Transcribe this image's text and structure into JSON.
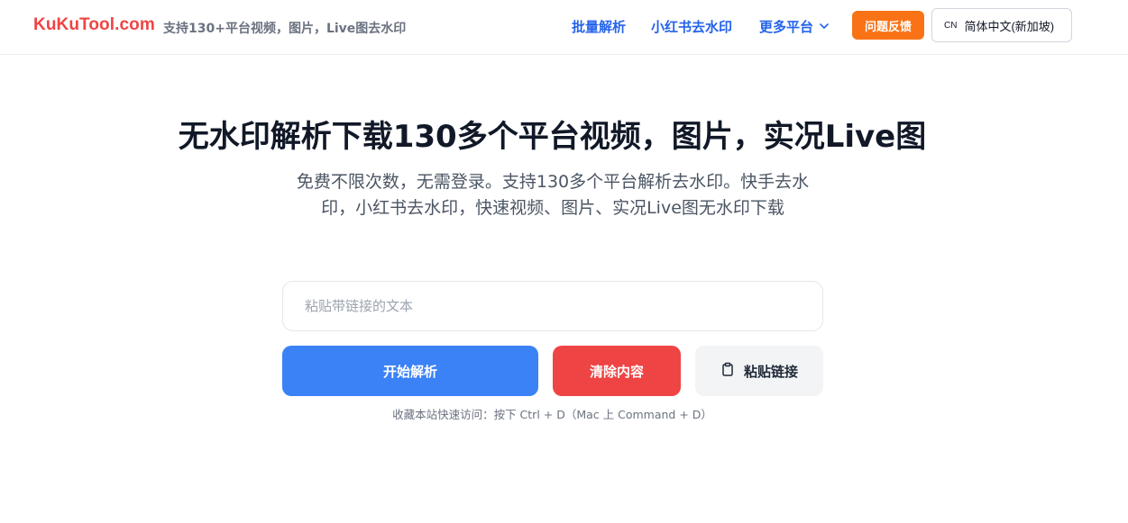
{
  "header": {
    "logo": "KuKuTool.com",
    "tagline": "支持130+平台视频，图片，Live图去水印",
    "nav": {
      "batch": "批量解析",
      "xhs": "小红书去水印",
      "more": "更多平台"
    },
    "feedback": "问题反馈",
    "lang": {
      "code": "CN",
      "label": "简体中文(新加坡)"
    }
  },
  "hero": {
    "title": "无水印解析下载130多个平台视频，图片，实况Live图",
    "subtitle": "免费不限次数，无需登录。支持130多个平台解析去水印。快手去水印，小红书去水印，快速视频、图片、实况Live图无水印下载"
  },
  "form": {
    "placeholder": "粘贴带链接的文本",
    "value": "",
    "parse_label": "开始解析",
    "clear_label": "清除内容",
    "paste_label": "粘贴链接"
  },
  "hint": "收藏本站快速访问：按下 Ctrl + D（Mac 上 Command + D）",
  "icons": {
    "more_chevron": "chevron-down-icon",
    "paste": "clipboard-icon"
  },
  "colors": {
    "brand": "#ef4444",
    "link": "#2563eb",
    "feedback": "#f97316",
    "primary": "#3b82f6",
    "danger": "#ef4444"
  }
}
